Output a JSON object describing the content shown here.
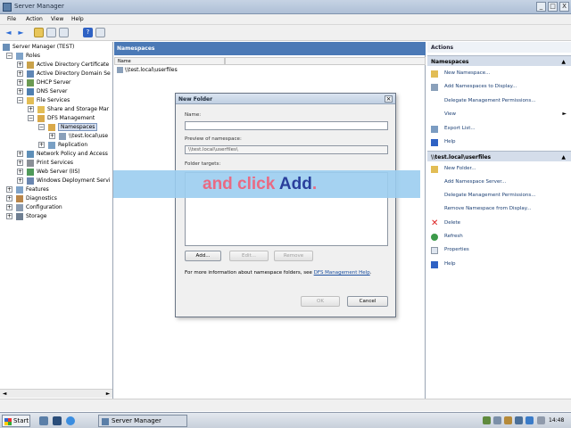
{
  "window": {
    "title": "Server Manager",
    "minimize": "_",
    "maximize": "□",
    "close": "X"
  },
  "menu": [
    "File",
    "Action",
    "View",
    "Help"
  ],
  "tree": {
    "items": [
      {
        "label": "Server Manager (TEST)",
        "expander": ""
      },
      {
        "label": "Roles",
        "expander": "−"
      },
      {
        "label": "Active Directory Certificate",
        "expander": "+"
      },
      {
        "label": "Active Directory Domain Se",
        "expander": "+"
      },
      {
        "label": "DHCP Server",
        "expander": "+"
      },
      {
        "label": "DNS Server",
        "expander": "+"
      },
      {
        "label": "File Services",
        "expander": "−"
      },
      {
        "label": "Share and Storage Mar",
        "expander": "+"
      },
      {
        "label": "DFS Management",
        "expander": "−"
      },
      {
        "label": "Namespaces",
        "expander": "−"
      },
      {
        "label": "\\\\test.local\\use",
        "expander": "+"
      },
      {
        "label": "Replication",
        "expander": "+"
      },
      {
        "label": "Network Policy and Access",
        "expander": "+"
      },
      {
        "label": "Print Services",
        "expander": "+"
      },
      {
        "label": "Web Server (IIS)",
        "expander": "+"
      },
      {
        "label": "Windows Deployment Servi",
        "expander": "+"
      },
      {
        "label": "Features",
        "expander": "+"
      },
      {
        "label": "Diagnostics",
        "expander": "+"
      },
      {
        "label": "Configuration",
        "expander": "+"
      },
      {
        "label": "Storage",
        "expander": "+"
      }
    ],
    "scroll_left": "◄",
    "scroll_right": "►"
  },
  "center": {
    "header": "Namespaces",
    "column_name": "Name",
    "row": "\\\\test.local\\userfiles"
  },
  "actions": {
    "header": "Actions",
    "section1": "Namespaces",
    "section1_items": [
      "New Namespace...",
      "Add Namespaces to Display...",
      "Delegate Management Permissions...",
      "View",
      "Export List...",
      "Help"
    ],
    "section2": "\\\\test.local\\userfiles",
    "section2_items": [
      "New Folder...",
      "Add Namespace Server...",
      "Delegate Management Permissions...",
      "Remove Namespace from Display...",
      "Delete",
      "Refresh",
      "Properties",
      "Help"
    ],
    "caret": "▲",
    "submenu_caret": "►"
  },
  "dialog": {
    "title": "New Folder",
    "close": "×",
    "name_label": "Name:",
    "name_value": "",
    "preview_label": "Preview of namespace:",
    "preview_value": "\\\\test.local\\userfiles\\",
    "targets_label": "Folder targets:",
    "add_button": "Add...",
    "edit_button": "Edit...",
    "remove_button": "Remove",
    "info_text": "For more information about namespace folders, see ",
    "info_link": "DFS Management Help",
    "info_end": ".",
    "ok_button": "OK",
    "cancel_button": "Cancel"
  },
  "overlay": {
    "word1": "and click ",
    "word2": "Add",
    "word3": "."
  },
  "taskbar": {
    "start": "Start",
    "task": "Server Manager",
    "clock": "14:48"
  }
}
